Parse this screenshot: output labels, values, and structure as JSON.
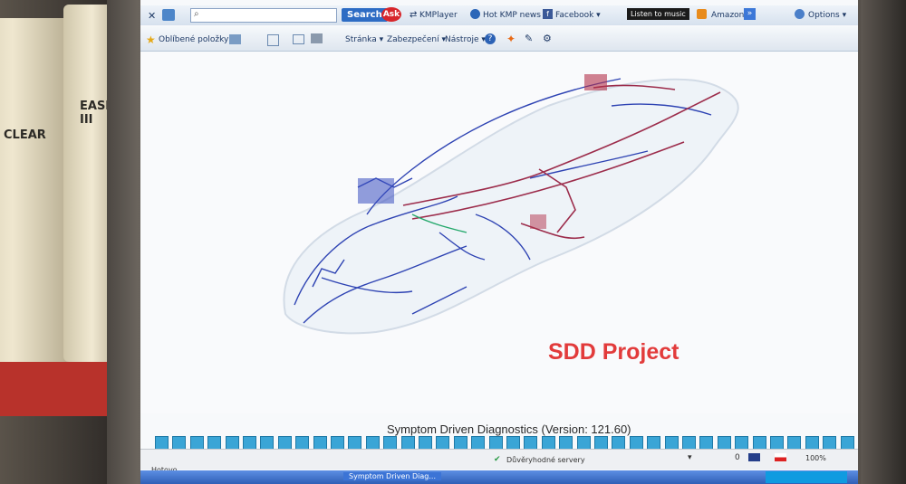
{
  "toolbar": {
    "search_button": "Search",
    "ask_logo": "Ask",
    "links": [
      "KMPlayer",
      "Hot KMP news ▾",
      "Facebook ▾"
    ],
    "listen_button": "Listen to music",
    "amazon": "Amazon",
    "options": "Options ▾"
  },
  "menu": {
    "favorites": "Oblíbené položky",
    "page": "Stránka ▾",
    "security": "Zabezpečení ▾",
    "tools": "Nástroje ▾"
  },
  "content": {
    "title": "SDD Project",
    "version_text": "Symptom Driven Diagnostics (Version: 121.60)"
  },
  "progress": {
    "segments": 40,
    "fraction": 1.0
  },
  "status": {
    "left": "Hotovo",
    "trusted": "Důvěryhodné servery",
    "zoom": "100%",
    "count": "0"
  },
  "taskbar": {
    "window": "Symptom Driven Diag..."
  },
  "colors": {
    "accent_blue": "#2d6cc4",
    "title_red": "#e23b3b",
    "progress_fill": "#3aa5d6"
  }
}
